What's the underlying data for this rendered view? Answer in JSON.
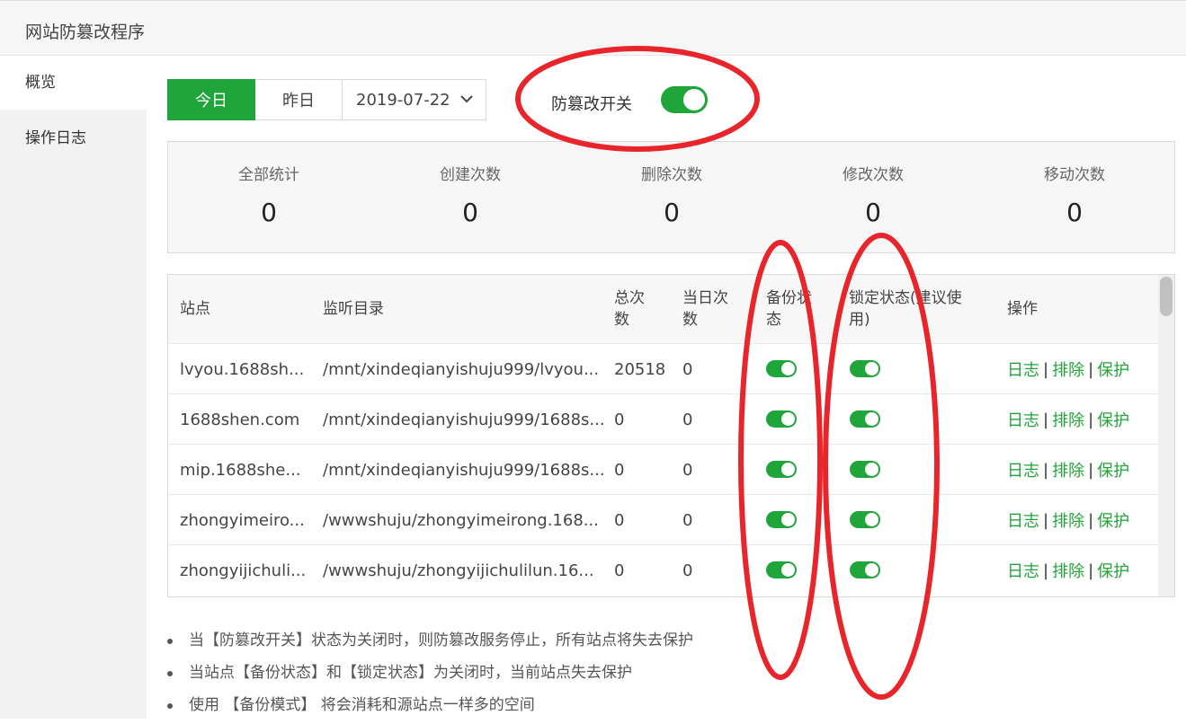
{
  "app": {
    "title": "网站防篡改程序"
  },
  "sidebar": {
    "items": [
      {
        "label": "概览",
        "active": true
      },
      {
        "label": "操作日志",
        "active": false
      }
    ]
  },
  "toolbar": {
    "today_label": "今日",
    "yesterday_label": "昨日",
    "date_value": "2019-07-22",
    "switch_label": "防篡改开关",
    "switch_on": true
  },
  "stats": [
    {
      "label": "全部统计",
      "value": "0"
    },
    {
      "label": "创建次数",
      "value": "0"
    },
    {
      "label": "删除次数",
      "value": "0"
    },
    {
      "label": "修改次数",
      "value": "0"
    },
    {
      "label": "移动次数",
      "value": "0"
    }
  ],
  "table": {
    "headers": {
      "site": "站点",
      "dir": "监听目录",
      "total_1": "总次",
      "total_2": "数",
      "daily_1": "当日次",
      "daily_2": "数",
      "backup_1": "备份状",
      "backup_2": "态",
      "lock_1": "锁定状态(建议使",
      "lock_2": "用)",
      "ops": "操作"
    },
    "rows": [
      {
        "site": "lvyou.1688sh...",
        "dir": "/mnt/xindeqianyishuju999/lvyou...",
        "total": "20518",
        "daily": "0",
        "backup": true,
        "lock": true
      },
      {
        "site": "1688shen.com",
        "dir": "/mnt/xindeqianyishuju999/1688s...",
        "total": "0",
        "daily": "0",
        "backup": true,
        "lock": true
      },
      {
        "site": "mip.1688she...",
        "dir": "/mnt/xindeqianyishuju999/1688s...",
        "total": "0",
        "daily": "0",
        "backup": true,
        "lock": true
      },
      {
        "site": "zhongyimeiro...",
        "dir": "/wwwshuju/zhongyimeirong.168...",
        "total": "0",
        "daily": "0",
        "backup": true,
        "lock": true
      },
      {
        "site": "zhongyijichuli...",
        "dir": "/wwwshuju/zhongyijichulilun.16...",
        "total": "0",
        "daily": "0",
        "backup": true,
        "lock": true
      }
    ],
    "ops": {
      "log": "日志",
      "exclude": "排除",
      "protect": "保护",
      "sep": "|"
    }
  },
  "notes": [
    "当【防篡改开关】状态为关闭时，则防篡改服务停止，所有站点将失去保护",
    "当站点【备份状态】和【锁定状态】为关闭时，当前站点失去保护",
    "使用 【备份模式】 将会消耗和源站点一样多的空间"
  ],
  "colors": {
    "accent": "#20a53a",
    "annotation": "#e8252b"
  }
}
